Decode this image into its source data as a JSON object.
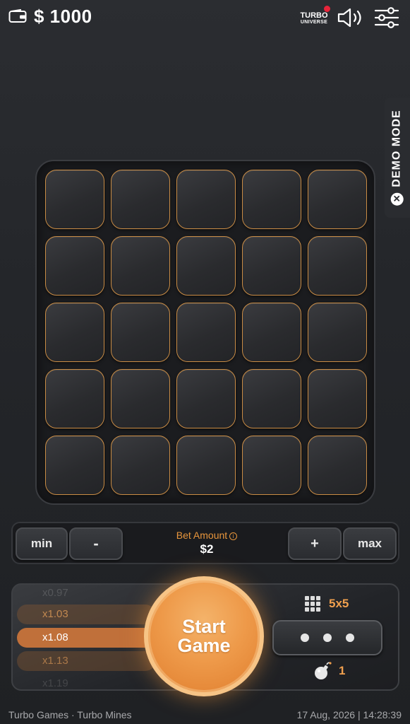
{
  "header": {
    "balance": "$ 1000",
    "logo_line1": "TURBO",
    "logo_line2": "UNIVERSE",
    "icons": [
      "wallet-icon",
      "speaker-icon",
      "settings-sliders-icon"
    ]
  },
  "demo_mode": {
    "label": "DEMO MODE",
    "close_glyph": "✕"
  },
  "board": {
    "rows": 5,
    "cols": 5,
    "tile_border_color": "#c98c45"
  },
  "bet": {
    "min_label": "min",
    "minus_label": "-",
    "amount_label": "Bet Amount",
    "info_glyph": "i",
    "amount_value": "$2",
    "plus_label": "+",
    "max_label": "max"
  },
  "multipliers": [
    "x0.97",
    "x1.03",
    "x1.08",
    "x1.13",
    "x1.19"
  ],
  "controls": {
    "start_line1": "Start",
    "start_line2": "Game",
    "grid_size": "5x5",
    "mines": "1"
  },
  "footer": {
    "left": "Turbo Games · Turbo Mines",
    "right": "17 Aug, 2026 | 14:28:39"
  },
  "colors": {
    "accent": "#f0a04e",
    "start_button": "#ee9a4a",
    "background": "#26282c"
  }
}
